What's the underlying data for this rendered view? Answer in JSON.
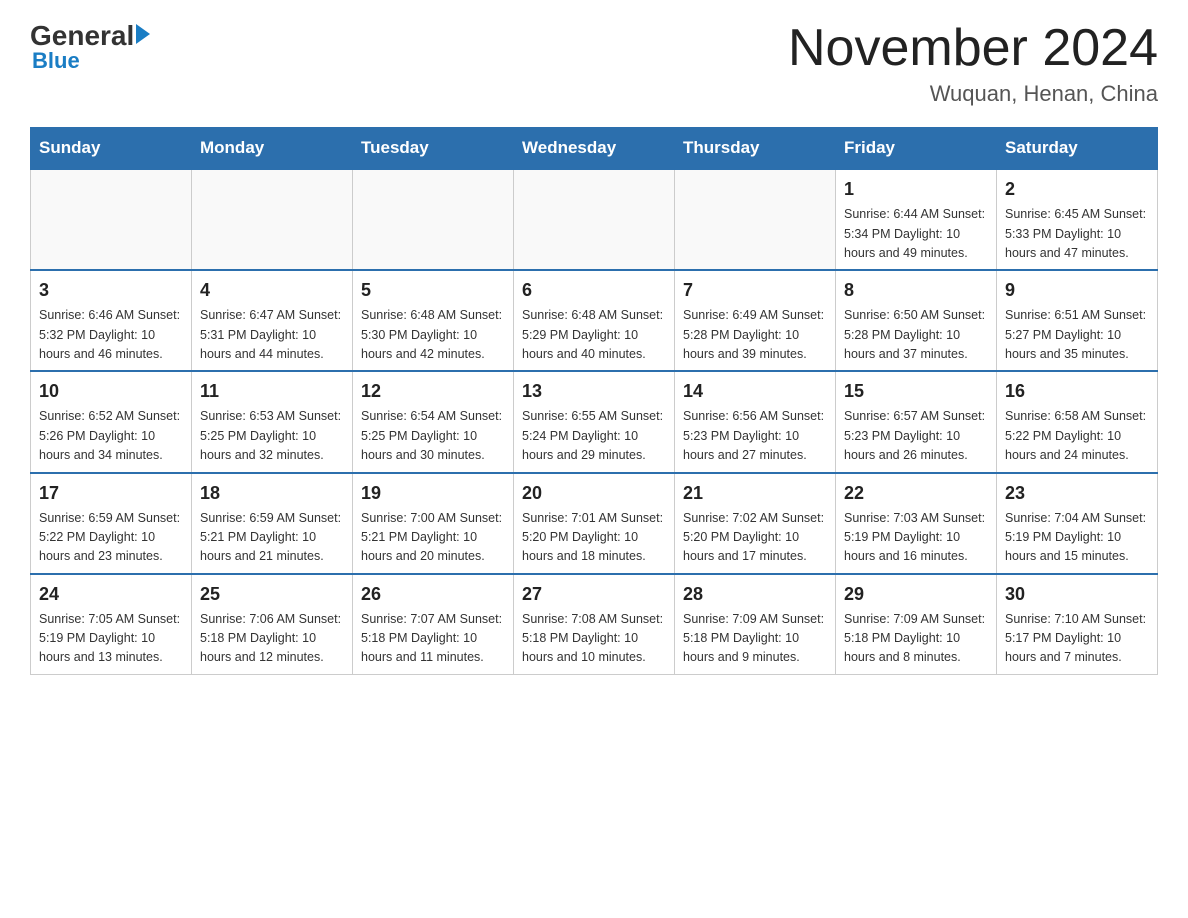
{
  "header": {
    "logo_general": "General",
    "logo_blue": "Blue",
    "month_title": "November 2024",
    "location": "Wuquan, Henan, China"
  },
  "weekdays": [
    "Sunday",
    "Monday",
    "Tuesday",
    "Wednesday",
    "Thursday",
    "Friday",
    "Saturday"
  ],
  "weeks": [
    [
      {
        "day": "",
        "info": ""
      },
      {
        "day": "",
        "info": ""
      },
      {
        "day": "",
        "info": ""
      },
      {
        "day": "",
        "info": ""
      },
      {
        "day": "",
        "info": ""
      },
      {
        "day": "1",
        "info": "Sunrise: 6:44 AM\nSunset: 5:34 PM\nDaylight: 10 hours and 49 minutes."
      },
      {
        "day": "2",
        "info": "Sunrise: 6:45 AM\nSunset: 5:33 PM\nDaylight: 10 hours and 47 minutes."
      }
    ],
    [
      {
        "day": "3",
        "info": "Sunrise: 6:46 AM\nSunset: 5:32 PM\nDaylight: 10 hours and 46 minutes."
      },
      {
        "day": "4",
        "info": "Sunrise: 6:47 AM\nSunset: 5:31 PM\nDaylight: 10 hours and 44 minutes."
      },
      {
        "day": "5",
        "info": "Sunrise: 6:48 AM\nSunset: 5:30 PM\nDaylight: 10 hours and 42 minutes."
      },
      {
        "day": "6",
        "info": "Sunrise: 6:48 AM\nSunset: 5:29 PM\nDaylight: 10 hours and 40 minutes."
      },
      {
        "day": "7",
        "info": "Sunrise: 6:49 AM\nSunset: 5:28 PM\nDaylight: 10 hours and 39 minutes."
      },
      {
        "day": "8",
        "info": "Sunrise: 6:50 AM\nSunset: 5:28 PM\nDaylight: 10 hours and 37 minutes."
      },
      {
        "day": "9",
        "info": "Sunrise: 6:51 AM\nSunset: 5:27 PM\nDaylight: 10 hours and 35 minutes."
      }
    ],
    [
      {
        "day": "10",
        "info": "Sunrise: 6:52 AM\nSunset: 5:26 PM\nDaylight: 10 hours and 34 minutes."
      },
      {
        "day": "11",
        "info": "Sunrise: 6:53 AM\nSunset: 5:25 PM\nDaylight: 10 hours and 32 minutes."
      },
      {
        "day": "12",
        "info": "Sunrise: 6:54 AM\nSunset: 5:25 PM\nDaylight: 10 hours and 30 minutes."
      },
      {
        "day": "13",
        "info": "Sunrise: 6:55 AM\nSunset: 5:24 PM\nDaylight: 10 hours and 29 minutes."
      },
      {
        "day": "14",
        "info": "Sunrise: 6:56 AM\nSunset: 5:23 PM\nDaylight: 10 hours and 27 minutes."
      },
      {
        "day": "15",
        "info": "Sunrise: 6:57 AM\nSunset: 5:23 PM\nDaylight: 10 hours and 26 minutes."
      },
      {
        "day": "16",
        "info": "Sunrise: 6:58 AM\nSunset: 5:22 PM\nDaylight: 10 hours and 24 minutes."
      }
    ],
    [
      {
        "day": "17",
        "info": "Sunrise: 6:59 AM\nSunset: 5:22 PM\nDaylight: 10 hours and 23 minutes."
      },
      {
        "day": "18",
        "info": "Sunrise: 6:59 AM\nSunset: 5:21 PM\nDaylight: 10 hours and 21 minutes."
      },
      {
        "day": "19",
        "info": "Sunrise: 7:00 AM\nSunset: 5:21 PM\nDaylight: 10 hours and 20 minutes."
      },
      {
        "day": "20",
        "info": "Sunrise: 7:01 AM\nSunset: 5:20 PM\nDaylight: 10 hours and 18 minutes."
      },
      {
        "day": "21",
        "info": "Sunrise: 7:02 AM\nSunset: 5:20 PM\nDaylight: 10 hours and 17 minutes."
      },
      {
        "day": "22",
        "info": "Sunrise: 7:03 AM\nSunset: 5:19 PM\nDaylight: 10 hours and 16 minutes."
      },
      {
        "day": "23",
        "info": "Sunrise: 7:04 AM\nSunset: 5:19 PM\nDaylight: 10 hours and 15 minutes."
      }
    ],
    [
      {
        "day": "24",
        "info": "Sunrise: 7:05 AM\nSunset: 5:19 PM\nDaylight: 10 hours and 13 minutes."
      },
      {
        "day": "25",
        "info": "Sunrise: 7:06 AM\nSunset: 5:18 PM\nDaylight: 10 hours and 12 minutes."
      },
      {
        "day": "26",
        "info": "Sunrise: 7:07 AM\nSunset: 5:18 PM\nDaylight: 10 hours and 11 minutes."
      },
      {
        "day": "27",
        "info": "Sunrise: 7:08 AM\nSunset: 5:18 PM\nDaylight: 10 hours and 10 minutes."
      },
      {
        "day": "28",
        "info": "Sunrise: 7:09 AM\nSunset: 5:18 PM\nDaylight: 10 hours and 9 minutes."
      },
      {
        "day": "29",
        "info": "Sunrise: 7:09 AM\nSunset: 5:18 PM\nDaylight: 10 hours and 8 minutes."
      },
      {
        "day": "30",
        "info": "Sunrise: 7:10 AM\nSunset: 5:17 PM\nDaylight: 10 hours and 7 minutes."
      }
    ]
  ]
}
